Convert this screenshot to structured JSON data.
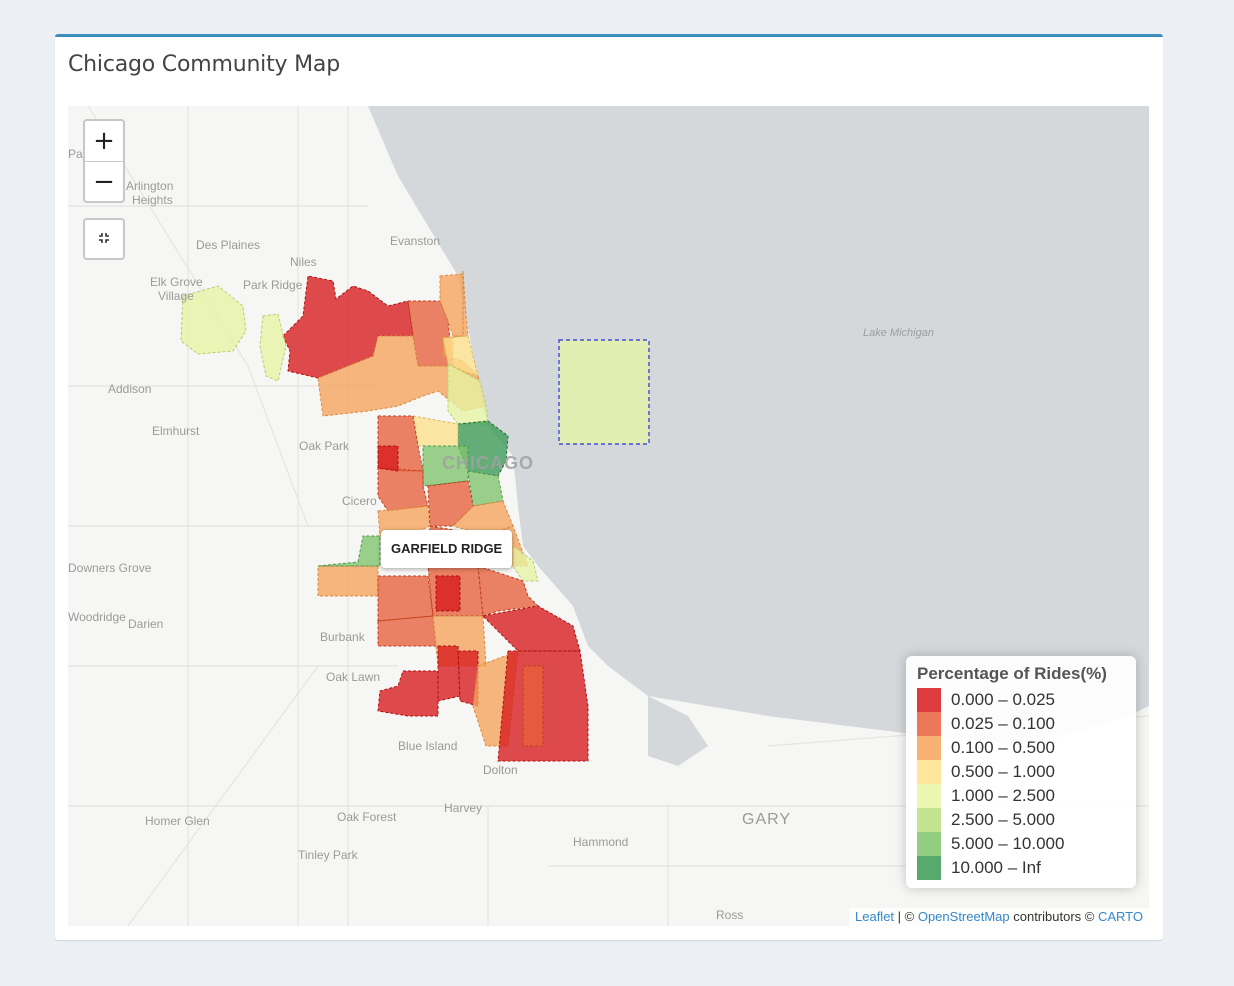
{
  "box": {
    "title": "Chicago Community Map"
  },
  "map": {
    "zoom_in": "+",
    "zoom_out": "−",
    "reset_icon": "⛶",
    "tooltip": "GARFIELD RIDGE",
    "lake_label": "Lake Michigan",
    "city_label": "CHICAGO",
    "place_labels": [
      "Pa",
      "Arlington Heights",
      "Des Plaines",
      "Evanston",
      "Niles",
      "Elk Grove Village",
      "Park Ridge",
      "Addison",
      "Elmhurst",
      "Oak Park",
      "Cicero",
      "Downers Grove",
      "Woodridge",
      "Darien",
      "Burbank",
      "Oak Lawn",
      "Blue Island",
      "Dolton",
      "Harvey",
      "Oak Forest",
      "Homer Glen",
      "Tinley Park",
      "Hammond",
      "GARY",
      "Ross"
    ]
  },
  "legend": {
    "title": "Percentage of Rides(%)",
    "items": [
      {
        "label": "0.000 – 0.025",
        "color": "#d7191c"
      },
      {
        "label": "0.025 – 0.100",
        "color": "#e8603b"
      },
      {
        "label": "0.100 – 0.500",
        "color": "#f5a35b"
      },
      {
        "label": "0.500 – 1.000",
        "color": "#fde08a"
      },
      {
        "label": "1.000 – 2.500",
        "color": "#e6f4a3"
      },
      {
        "label": "2.500 – 5.000",
        "color": "#b7df7d"
      },
      {
        "label": "5.000 – 10.000",
        "color": "#7fc46c"
      },
      {
        "label": "10.000 – Inf",
        "color": "#3a9a55"
      }
    ]
  },
  "attribution": {
    "leaflet": "Leaflet",
    "sep1": " | © ",
    "osm": "OpenStreetMap",
    "contributors": " contributors © ",
    "carto": "CARTO"
  }
}
